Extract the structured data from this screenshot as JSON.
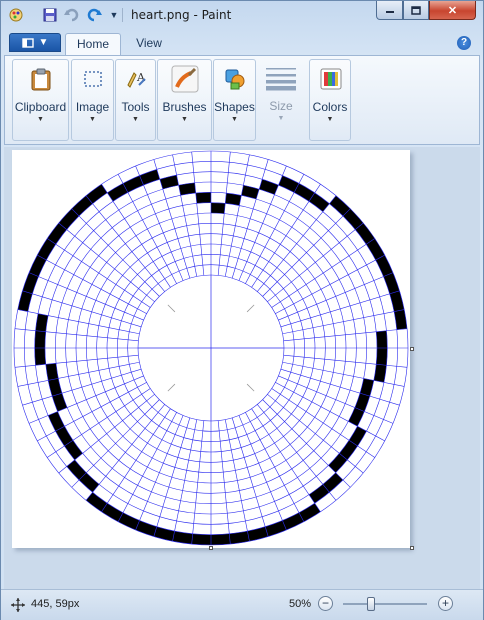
{
  "window": {
    "title": "heart.png - Paint",
    "qat_icons": [
      "paint-app-icon",
      "save-icon",
      "undo-icon",
      "redo-icon",
      "customize-qat-icon"
    ],
    "controls": [
      "minimize",
      "maximize",
      "close"
    ]
  },
  "ribbon": {
    "tabs": [
      {
        "label": "Home",
        "active": true
      },
      {
        "label": "View",
        "active": false
      }
    ],
    "groups": [
      {
        "label": "Clipboard",
        "icon": "clipboard-icon",
        "enabled": true
      },
      {
        "label": "Image",
        "icon": "image-select-icon",
        "enabled": true
      },
      {
        "label": "Tools",
        "icon": "tools-icon",
        "enabled": true
      },
      {
        "label": "Brushes",
        "icon": "brush-icon",
        "enabled": true
      },
      {
        "label": "Shapes",
        "icon": "shapes-icon",
        "enabled": true
      },
      {
        "label": "Size",
        "icon": "size-icon",
        "enabled": false
      },
      {
        "label": "Colors",
        "icon": "colors-icon",
        "enabled": true
      }
    ]
  },
  "canvas": {
    "image": "heart.png",
    "grid_color": "#2a2aee",
    "fill_color": "#000000",
    "rings": 12,
    "sectors": 64
  },
  "status": {
    "cursor_position": "445, 59px",
    "zoom_level": "50%",
    "zoom_percent": 50
  },
  "colors": {
    "accent": "#1a55a6",
    "ribbon_bg": "#f5f9fd",
    "workspace_bg": "#cbdaeb"
  }
}
